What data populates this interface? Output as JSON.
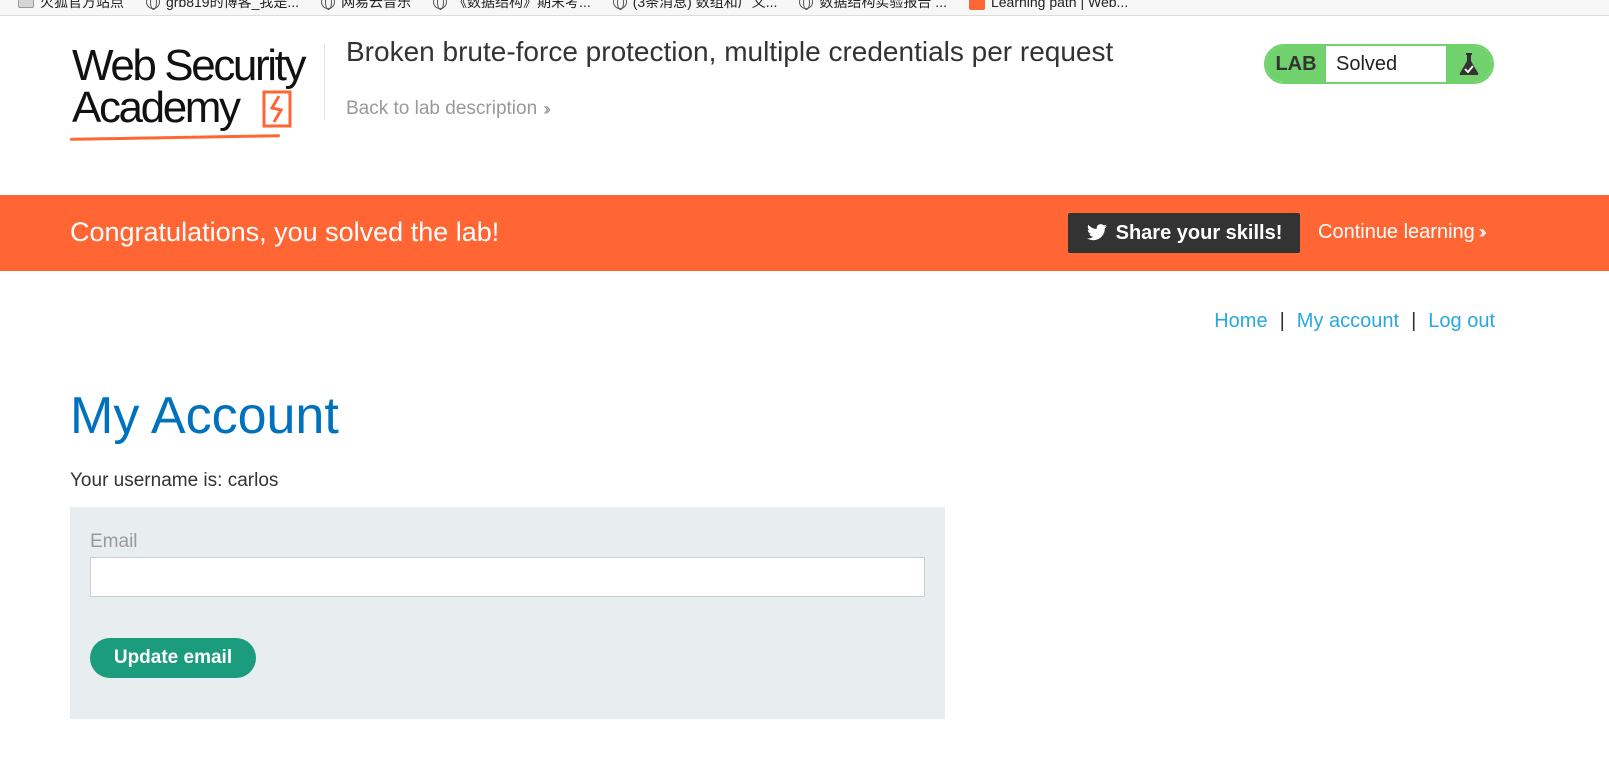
{
  "bookmarks": [
    {
      "label": "火狐官方站点",
      "icon": "folder-icon"
    },
    {
      "label": "grb819的博客_我是...",
      "icon": "globe-icon"
    },
    {
      "label": "网易云音乐",
      "icon": "globe-icon"
    },
    {
      "label": "《数据结构》期末考...",
      "icon": "globe-icon"
    },
    {
      "label": "(3条消息) 数组和广义...",
      "icon": "globe-icon"
    },
    {
      "label": "数据结构实验报告 ...",
      "icon": "globe-icon"
    },
    {
      "label": "Learning path | Web...",
      "icon": "portswigger-icon"
    }
  ],
  "header": {
    "logo_line1": "Web Security",
    "logo_line2": "Academy",
    "lab_title": "Broken brute-force protection, multiple credentials per request",
    "back_link": "Back to lab description",
    "status_label": "LAB",
    "status_value": "Solved"
  },
  "banner": {
    "message": "Congratulations, you solved the lab!",
    "share_label": "Share your skills!",
    "continue_label": "Continue learning"
  },
  "nav": {
    "home": "Home",
    "my_account": "My account",
    "log_out": "Log out",
    "separator": "|"
  },
  "main": {
    "title": "My Account",
    "username_line": "Your username is: carlos",
    "email_label": "Email",
    "email_value": "",
    "update_button": "Update email"
  },
  "colors": {
    "brand_orange": "#ff6633",
    "solved_green": "#70d16d",
    "title_blue": "#0071bc",
    "link_blue": "#29a7e1",
    "button_teal": "#1a9c7d"
  }
}
